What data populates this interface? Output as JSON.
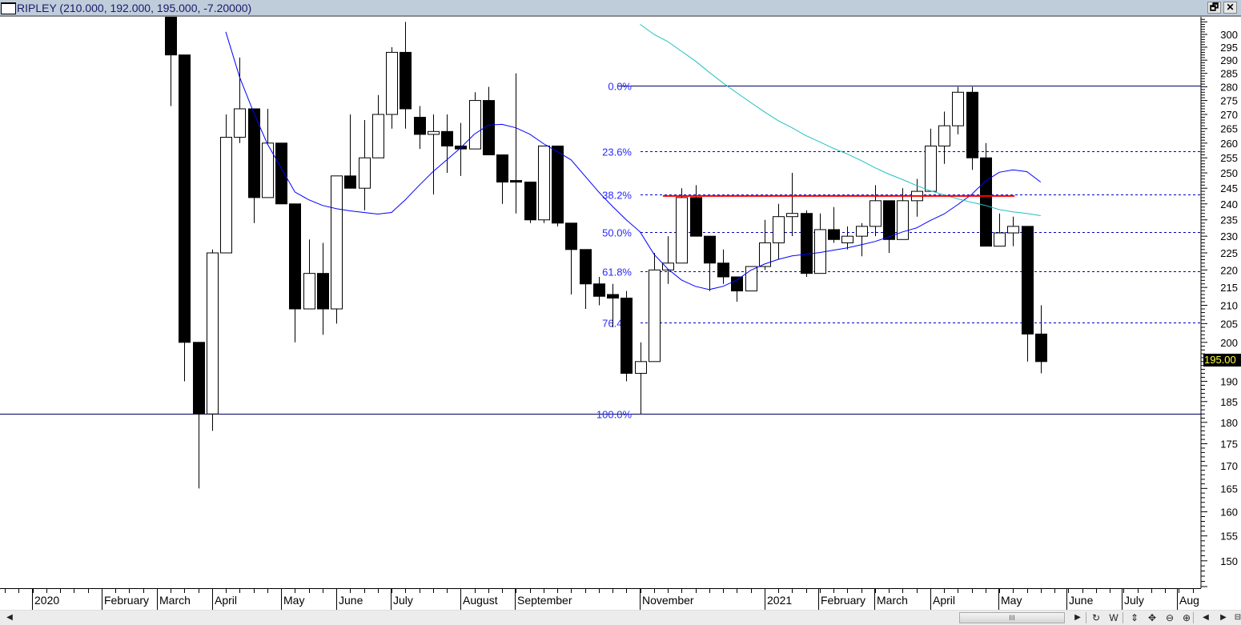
{
  "window": {
    "title": "RIPLEY (210.000, 192.000, 195.000, -7.20000)",
    "restore_icon": "restore-window-icon",
    "close_icon": "close-icon",
    "restore_label": "🗗",
    "close_label": "✕"
  },
  "chart_data": {
    "type": "candlestick",
    "symbol": "RIPLEY",
    "interval": "weekly",
    "yscale": "log",
    "ylim": [
      143,
      306
    ],
    "yticks": [
      150,
      155,
      160,
      165,
      170,
      175,
      180,
      185,
      190,
      195,
      200,
      205,
      210,
      215,
      220,
      225,
      230,
      235,
      240,
      245,
      250,
      255,
      260,
      265,
      270,
      275,
      280,
      285,
      290,
      295,
      300
    ],
    "xtick_labels": [
      "2020",
      "February",
      "March",
      "April",
      "May",
      "June",
      "July",
      "August",
      "September",
      "November",
      "2021",
      "February",
      "March",
      "April",
      "May",
      "June",
      "July",
      "Aug"
    ],
    "last_price_label": "195.00",
    "last_price": 195.0,
    "colors": {
      "up_fill": "#ffffff",
      "down_fill": "#000000",
      "ma_fast": "#0000ff",
      "ma_slow": "#20c0c0",
      "fib_text": "#2a2aff",
      "fib_line": "#0000c0",
      "resistance": "#ff0000",
      "price_tag_bg": "#000000",
      "price_tag_text": "#ffff40"
    },
    "candles": [
      {
        "o": 315,
        "h": 320,
        "l": 273,
        "c": 292
      },
      {
        "o": 292,
        "h": 292,
        "l": 190,
        "c": 200
      },
      {
        "o": 200,
        "h": 200,
        "l": 165,
        "c": 182
      },
      {
        "o": 182,
        "h": 226,
        "l": 178,
        "c": 225
      },
      {
        "o": 225,
        "h": 270,
        "l": 225,
        "c": 262
      },
      {
        "o": 262,
        "h": 291,
        "l": 260,
        "c": 272
      },
      {
        "o": 272,
        "h": 272,
        "l": 234,
        "c": 242
      },
      {
        "o": 242,
        "h": 272,
        "l": 242,
        "c": 260
      },
      {
        "o": 260,
        "h": 260,
        "l": 240,
        "c": 240
      },
      {
        "o": 240,
        "h": 240,
        "l": 200,
        "c": 209
      },
      {
        "o": 209,
        "h": 229,
        "l": 209,
        "c": 219
      },
      {
        "o": 219,
        "h": 228,
        "l": 202,
        "c": 209
      },
      {
        "o": 209,
        "h": 249,
        "l": 205,
        "c": 249
      },
      {
        "o": 249,
        "h": 270,
        "l": 245,
        "c": 245
      },
      {
        "o": 245,
        "h": 268,
        "l": 238,
        "c": 255
      },
      {
        "o": 255,
        "h": 277,
        "l": 255,
        "c": 270
      },
      {
        "o": 270,
        "h": 295,
        "l": 265,
        "c": 293
      },
      {
        "o": 293,
        "h": 305,
        "l": 265,
        "c": 272
      },
      {
        "o": 269,
        "h": 273,
        "l": 258,
        "c": 263
      },
      {
        "o": 263,
        "h": 270,
        "l": 243,
        "c": 264
      },
      {
        "o": 264,
        "h": 270,
        "l": 250,
        "c": 259
      },
      {
        "o": 259,
        "h": 267,
        "l": 249,
        "c": 258
      },
      {
        "o": 258,
        "h": 278,
        "l": 258,
        "c": 275
      },
      {
        "o": 275,
        "h": 280,
        "l": 256,
        "c": 256
      },
      {
        "o": 256,
        "h": 256,
        "l": 240,
        "c": 247
      },
      {
        "o": 247.5,
        "h": 285,
        "l": 237,
        "c": 247
      },
      {
        "o": 247,
        "h": 247,
        "l": 234,
        "c": 235
      },
      {
        "o": 235,
        "h": 259,
        "l": 234,
        "c": 259
      },
      {
        "o": 259,
        "h": 259,
        "l": 233,
        "c": 234
      },
      {
        "o": 234,
        "h": 234,
        "l": 213,
        "c": 226
      },
      {
        "o": 226,
        "h": 226,
        "l": 209,
        "c": 216
      },
      {
        "o": 216,
        "h": 218,
        "l": 210,
        "c": 212.5
      },
      {
        "o": 213,
        "h": 216,
        "l": 204,
        "c": 212
      },
      {
        "o": 212,
        "h": 214,
        "l": 190,
        "c": 192
      },
      {
        "o": 192,
        "h": 200,
        "l": 182,
        "c": 195
      },
      {
        "o": 195,
        "h": 225,
        "l": 195,
        "c": 220
      },
      {
        "o": 220,
        "h": 230,
        "l": 216,
        "c": 222
      },
      {
        "o": 222,
        "h": 245,
        "l": 222,
        "c": 242
      },
      {
        "o": 242,
        "h": 246,
        "l": 230,
        "c": 230
      },
      {
        "o": 230,
        "h": 230,
        "l": 214,
        "c": 222
      },
      {
        "o": 222,
        "h": 226,
        "l": 216,
        "c": 218
      },
      {
        "o": 218,
        "h": 218,
        "l": 211,
        "c": 214
      },
      {
        "o": 214,
        "h": 221,
        "l": 214,
        "c": 221
      },
      {
        "o": 221,
        "h": 235,
        "l": 220,
        "c": 228
      },
      {
        "o": 228,
        "h": 240,
        "l": 223,
        "c": 236
      },
      {
        "o": 236,
        "h": 250,
        "l": 230,
        "c": 237
      },
      {
        "o": 237,
        "h": 238,
        "l": 218,
        "c": 219
      },
      {
        "o": 219,
        "h": 237,
        "l": 219,
        "c": 232
      },
      {
        "o": 232,
        "h": 239,
        "l": 228,
        "c": 229
      },
      {
        "o": 228,
        "h": 233,
        "l": 226,
        "c": 230
      },
      {
        "o": 230,
        "h": 234,
        "l": 224,
        "c": 233
      },
      {
        "o": 233,
        "h": 246,
        "l": 230,
        "c": 241
      },
      {
        "o": 241,
        "h": 241,
        "l": 225,
        "c": 229
      },
      {
        "o": 229,
        "h": 245,
        "l": 229,
        "c": 241
      },
      {
        "o": 241,
        "h": 248,
        "l": 236,
        "c": 244
      },
      {
        "o": 244,
        "h": 265,
        "l": 244,
        "c": 259
      },
      {
        "o": 259,
        "h": 271,
        "l": 253,
        "c": 266
      },
      {
        "o": 266,
        "h": 280,
        "l": 263,
        "c": 278
      },
      {
        "o": 278,
        "h": 280,
        "l": 251,
        "c": 255
      },
      {
        "o": 255,
        "h": 260,
        "l": 227,
        "c": 227
      },
      {
        "o": 227,
        "h": 237,
        "l": 227,
        "c": 231
      },
      {
        "o": 231,
        "h": 236,
        "l": 227,
        "c": 233
      },
      {
        "o": 233,
        "h": 233,
        "l": 195,
        "c": 202.2
      },
      {
        "o": 202.2,
        "h": 210,
        "l": 192,
        "c": 195
      }
    ],
    "ma_fast": [
      null,
      null,
      null,
      null,
      301,
      283.6,
      270.9,
      259.8,
      251.7,
      243.8,
      241.3,
      239.5,
      238.5,
      237.8,
      237.3,
      236.8,
      237.3,
      241.3,
      245.9,
      250.4,
      254.3,
      258.4,
      263.1,
      266.2,
      266.5,
      265.3,
      263.1,
      259.8,
      257.1,
      254.3,
      249,
      243.8,
      239.2,
      235,
      231.3,
      224.6,
      220.3,
      217.1,
      215.3,
      214.4,
      215.3,
      217.1,
      219.9,
      221.7,
      223.1,
      224.1,
      224.6,
      225.1,
      225.8,
      226.5,
      227.4,
      228.4,
      229.8,
      231.3,
      232.5,
      234.8,
      236.8,
      239.8,
      243,
      247.3,
      250.2,
      251,
      250.4,
      247
    ],
    "ma_slow": [
      null,
      null,
      null,
      null,
      null,
      null,
      null,
      null,
      null,
      null,
      null,
      null,
      null,
      null,
      null,
      null,
      null,
      null,
      null,
      null,
      null,
      null,
      null,
      null,
      null,
      null,
      null,
      null,
      null,
      null,
      null,
      null,
      null,
      null,
      304,
      300,
      297.2,
      293.4,
      289.7,
      285.4,
      281.4,
      277.8,
      274.3,
      270.9,
      267.8,
      265.3,
      262.6,
      260.4,
      258.2,
      256.3,
      254.1,
      251.7,
      249.6,
      247.8,
      245.9,
      244.2,
      242.9,
      241.6,
      240.5,
      239.5,
      238.2,
      237.5,
      237,
      236.3
    ],
    "fibonacci": {
      "high": 280.5,
      "low": 182,
      "levels": [
        {
          "label": "0.0%",
          "ratio": 0.0
        },
        {
          "label": "23.6%",
          "ratio": 0.236
        },
        {
          "label": "38.2%",
          "ratio": 0.382
        },
        {
          "label": "50.0%",
          "ratio": 0.5
        },
        {
          "label": "61.8%",
          "ratio": 0.618
        },
        {
          "label": "76.4%",
          "ratio": 0.764
        },
        {
          "label": "100.0%",
          "ratio": 1.0
        }
      ]
    },
    "resistance_line": {
      "price": 242.5,
      "from_candle": 36,
      "to_candle": 61
    }
  },
  "toolbar": {
    "scroll_thumb_label": "III",
    "buttons": [
      {
        "name": "scroll-left-icon",
        "glyph": "◀"
      },
      {
        "name": "scroll-right-icon",
        "glyph": "▶"
      },
      {
        "name": "refresh-icon",
        "glyph": "↻"
      },
      {
        "name": "weekly-icon",
        "glyph": "W"
      },
      {
        "name": "vertical-scale-icon",
        "glyph": "⇕"
      },
      {
        "name": "move-icon",
        "glyph": "✥"
      },
      {
        "name": "zoom-out-icon",
        "glyph": "⊖"
      },
      {
        "name": "zoom-in-icon",
        "glyph": "⊕"
      },
      {
        "name": "prev-icon",
        "glyph": "◀"
      },
      {
        "name": "next-icon",
        "glyph": "▶"
      },
      {
        "name": "properties-icon",
        "glyph": "⊟"
      }
    ]
  }
}
